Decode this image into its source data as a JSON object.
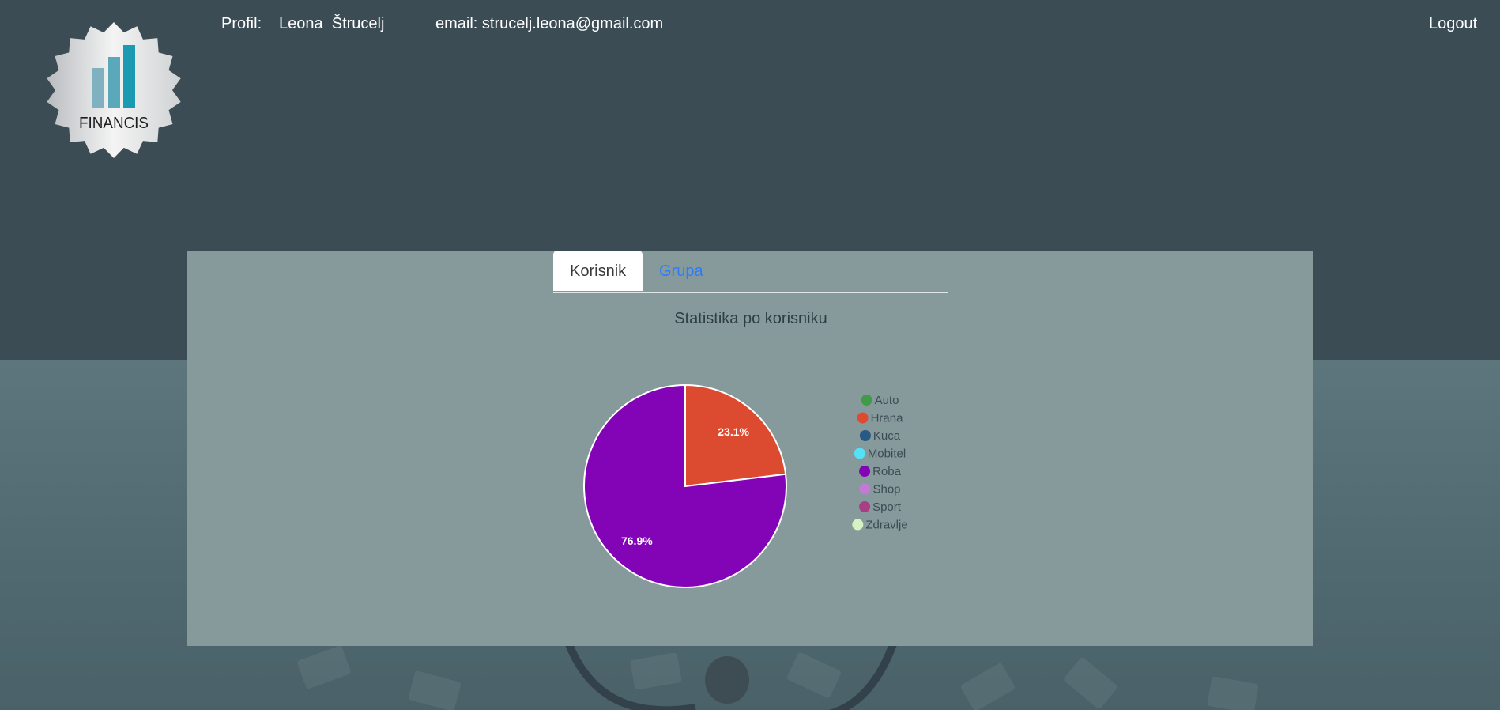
{
  "header": {
    "profil_label": "Profil:",
    "profil_name": "Leona  Štrucelj",
    "email": "email: strucelj.leona@gmail.com",
    "logout_label": "Logout"
  },
  "logo": {
    "text": "FINANCIS"
  },
  "tabs": [
    {
      "label": "Korisnik",
      "active": true
    },
    {
      "label": "Grupa",
      "active": false
    }
  ],
  "chart_data": {
    "type": "pie",
    "title": "Statistika po korisniku",
    "categories": [
      "Auto",
      "Hrana",
      "Kuca",
      "Mobitel",
      "Roba",
      "Shop",
      "Sport",
      "Zdravlje"
    ],
    "colors": [
      "#3f9b48",
      "#dc4b30",
      "#285a86",
      "#54e0f5",
      "#8304b6",
      "#c27ad4",
      "#aa3e85",
      "#d6f2c5"
    ],
    "values": [
      0,
      23.1,
      0,
      0,
      76.9,
      0,
      0,
      0
    ],
    "value_labels": [
      "",
      "23.1%",
      "",
      "",
      "76.9%",
      "",
      "",
      ""
    ],
    "legend": "right"
  }
}
